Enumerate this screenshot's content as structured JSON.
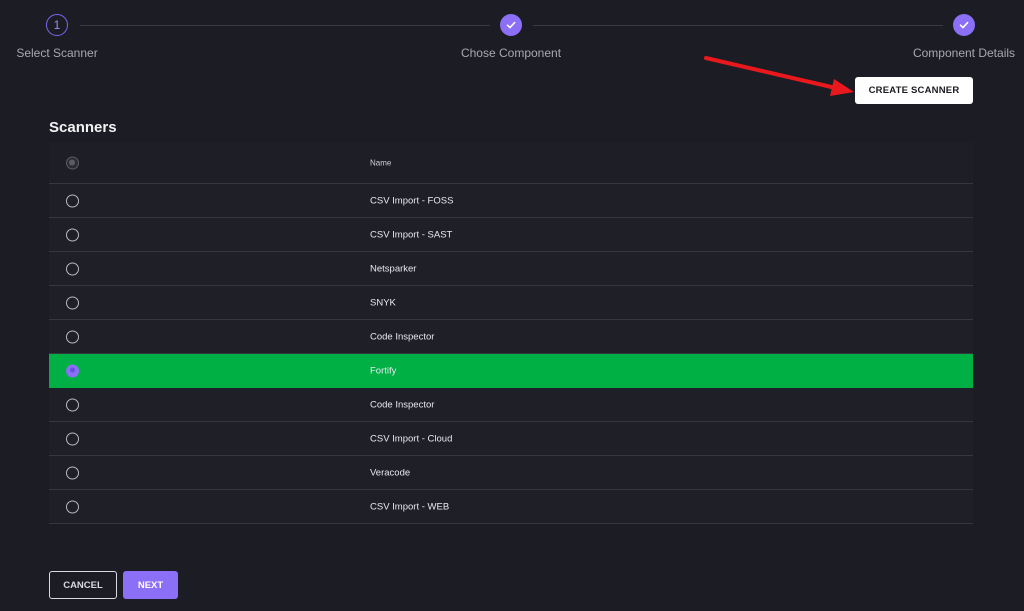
{
  "stepper": {
    "steps": [
      {
        "number": "1",
        "label": "Select Scanner",
        "state": "current"
      },
      {
        "label": "Chose Component",
        "state": "done"
      },
      {
        "label": "Component Details",
        "state": "done"
      }
    ]
  },
  "toolbar": {
    "create_label": "CREATE SCANNER"
  },
  "scanners": {
    "title": "Scanners",
    "column_name": "Name",
    "rows": [
      {
        "name": "CSV Import - FOSS",
        "selected": false
      },
      {
        "name": "CSV Import - SAST",
        "selected": false
      },
      {
        "name": "Netsparker",
        "selected": false
      },
      {
        "name": "SNYK",
        "selected": false
      },
      {
        "name": "Code Inspector",
        "selected": false
      },
      {
        "name": "Fortify",
        "selected": true
      },
      {
        "name": "Code Inspector",
        "selected": false
      },
      {
        "name": "CSV Import - Cloud",
        "selected": false
      },
      {
        "name": "Veracode",
        "selected": false
      },
      {
        "name": "CSV Import - WEB",
        "selected": false
      }
    ]
  },
  "footer": {
    "cancel_label": "CANCEL",
    "next_label": "NEXT"
  },
  "colors": {
    "accent": "#8b6ff7",
    "selected_row": "#00b044",
    "background": "#1c1c24",
    "annotation_arrow": "#e8181c"
  },
  "icons": {
    "done": "check-icon",
    "annotation": "red-arrow"
  }
}
